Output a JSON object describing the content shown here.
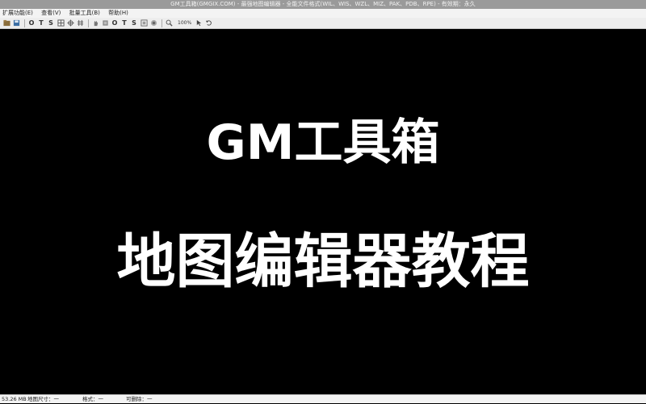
{
  "window": {
    "title": "GM工具箱(GMGIX.COM) - 最强地图编辑器 - 全能文件格式(WIL、WIS、WZL、MIZ、PAK、PDB、RPE) - 有效期：永久"
  },
  "menu": {
    "items": [
      "扩展功能(E)",
      "查看(V)",
      "批量工具(B)",
      "帮助(H)"
    ]
  },
  "toolbar": {
    "icons": [
      "open-icon",
      "save-icon",
      "O",
      "T",
      "S",
      "grid-icon",
      "star-icon",
      "hash-icon",
      "hand-icon",
      "fill-icon",
      "O",
      "T",
      "S",
      "frame-icon",
      "layer-icon",
      "zoom-icon",
      "pointer-icon",
      "undo-icon"
    ],
    "zoom_label": "100%"
  },
  "canvas": {
    "line1": "GM工具箱",
    "line2": "地图编辑器教程"
  },
  "status": {
    "memory": "53.26 MB",
    "map_size_label": "地图尺寸：一",
    "format_label": "格式：一",
    "view_label": "可删除：一"
  }
}
